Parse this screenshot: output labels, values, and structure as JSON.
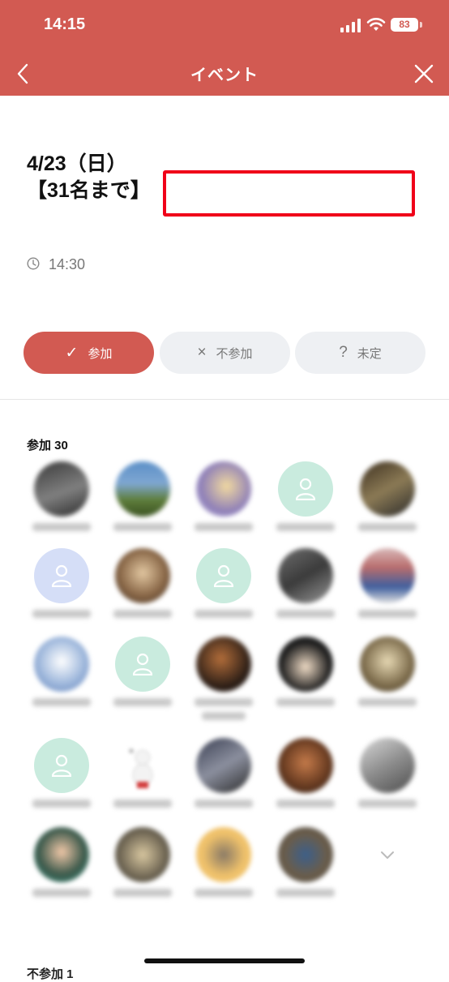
{
  "status": {
    "time": "14:15",
    "battery": "83"
  },
  "nav": {
    "title": "イベント"
  },
  "event": {
    "title_line1": "4/23（日）",
    "title_line2": "【31名まで】",
    "time": "14:30"
  },
  "rsvp": {
    "attend_label": "参加",
    "attend_mark": "✓",
    "decline_label": "不参加",
    "decline_mark": "×",
    "undecided_label": "未定",
    "undecided_mark": "?"
  },
  "attendees": {
    "title": "参加 30"
  },
  "next_section": {
    "title": "不参加 1"
  },
  "colors": {
    "accent": "#d25a52",
    "redact_box": "#f00019",
    "pill_bg": "#eef0f3"
  },
  "icons": {
    "back": "chevron-left-icon",
    "close": "close-icon",
    "clock": "clock-icon",
    "default_avatar": "person-icon",
    "more": "chevron-down-icon"
  }
}
